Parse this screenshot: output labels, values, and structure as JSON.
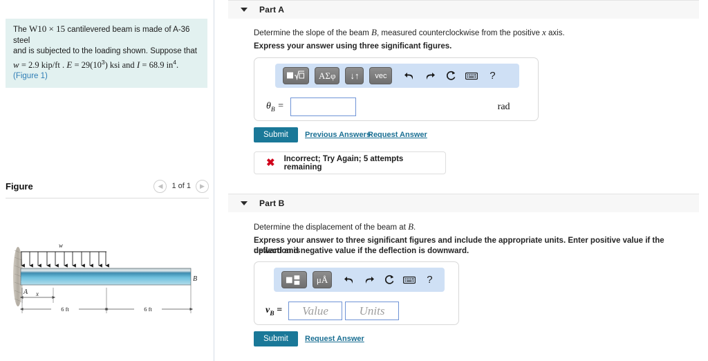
{
  "problem": {
    "line1_pre": "The ",
    "beam_designation": "W10 × 15",
    "line1_post": " cantilevered beam is made of A-36 steel",
    "line2": "and is subjected to the loading shown. Suppose that",
    "w_symbol": "w",
    "w_value": "= 2.9  kip/ft .",
    "E_symbol": "E",
    "E_value": "= 29(10",
    "E_exp": "3",
    "E_unit": ") ksi and",
    "I_symbol": "I",
    "I_value": "= 68.9 in",
    "I_exp": "4",
    "I_end": ".",
    "figure_link": "(Figure 1)"
  },
  "figure": {
    "title": "Figure",
    "pager_prev_icon": "chevron-left-icon",
    "pager_next_icon": "chevron-right-icon",
    "pager_label": "1 of 1",
    "labels": {
      "load": "w",
      "support": "A",
      "free_end": "B",
      "x_dim": "x",
      "span_left": "6 ft",
      "span_right": "6 ft"
    }
  },
  "partA": {
    "caret_icon": "caret-down-icon",
    "title": "Part A",
    "question_pre": "Determine the slope of the beam ",
    "question_var": "B",
    "question_mid": ", measured counterclockwise from the positive ",
    "question_var2": "x",
    "question_post": " axis.",
    "instruction": "Express your answer using three significant figures.",
    "toolbar": {
      "template_icon": "math-template-icon",
      "greek_label": "ΑΣφ",
      "updown_label": "↓↑",
      "vec_label": "vec",
      "undo_icon": "undo-icon",
      "redo_icon": "redo-icon",
      "reset_icon": "reset-icon",
      "keyboard_icon": "keyboard-icon",
      "help_icon": "help-icon"
    },
    "answer_label": "θ",
    "answer_label_sub": "B",
    "answer_equals": "=",
    "answer_value": "",
    "units": "rad",
    "submit_label": "Submit",
    "previous_answers_label": "Previous Answers",
    "request_answer_label": "Request Answer",
    "feedback_icon": "x-mark-icon",
    "feedback_text": "Incorrect; Try Again; 5 attempts remaining"
  },
  "partB": {
    "caret_icon": "caret-down-icon",
    "title": "Part B",
    "question_pre": "Determine the displacement of the beam at ",
    "question_var": "B",
    "question_post": ".",
    "instruction_line1": "Express your answer to three significant figures and include the appropriate units. Enter positive value if the deflection is",
    "instruction_line2": "upward and negative value if the deflection is downward.",
    "toolbar": {
      "template_icon": "value-units-template-icon",
      "units_label": "μÅ",
      "undo_icon": "undo-icon",
      "redo_icon": "redo-icon",
      "reset_icon": "reset-icon",
      "keyboard_icon": "keyboard-icon",
      "help_icon": "help-icon"
    },
    "answer_label": "v",
    "answer_label_sub": "B",
    "answer_equals": "=",
    "value_placeholder": "Value",
    "units_placeholder": "Units",
    "submit_label": "Submit",
    "request_answer_label": "Request Answer"
  },
  "colors": {
    "accent_teal": "#1a7898",
    "link_blue": "#1a6f93",
    "toolbar_blue": "#cfe0f5",
    "problem_bg": "#e2f1f0",
    "error_red": "#d0021b",
    "beam_blue": "#4ea4c8"
  }
}
